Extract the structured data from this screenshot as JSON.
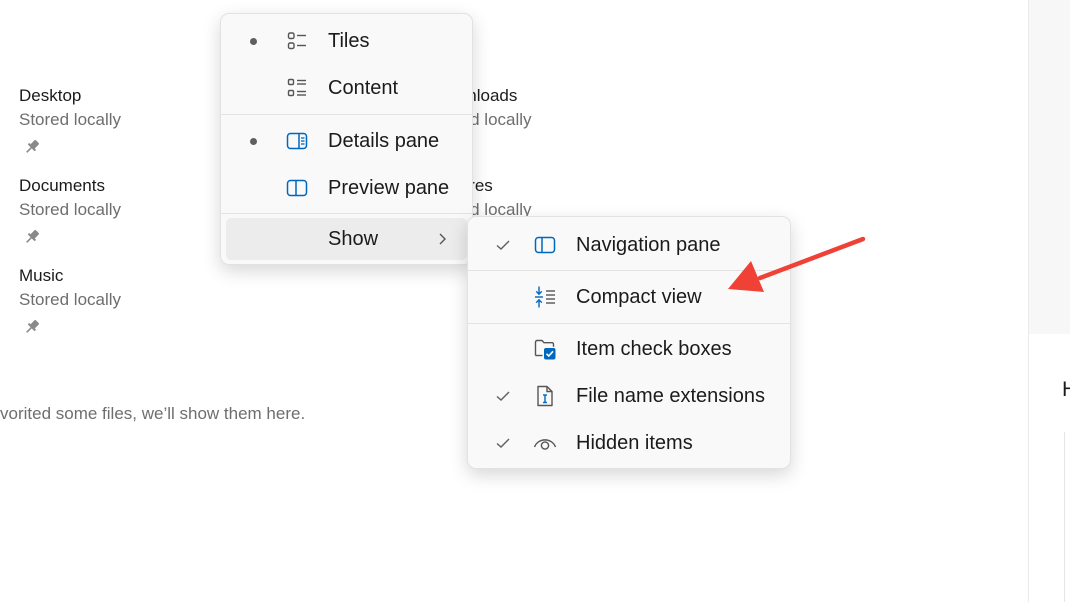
{
  "quick_access": [
    {
      "name": "Desktop",
      "status": "Stored locally"
    },
    {
      "name": "Documents",
      "status": "Stored locally"
    },
    {
      "name": "Music",
      "status": "Stored locally"
    }
  ],
  "quick_access_right": [
    {
      "name": "wnloads",
      "status": "red locally"
    },
    {
      "name": "tures",
      "status": "red locally"
    }
  ],
  "favorites_empty_message": "vorited some files, we’ll show them here.",
  "right_panel_heading_fragment": "H",
  "view_menu": {
    "items": [
      {
        "label": "Tiles",
        "icon": "tiles-icon",
        "selected": true
      },
      {
        "label": "Content",
        "icon": "content-icon",
        "selected": false
      },
      {
        "label": "Details pane",
        "icon": "details-pane-icon",
        "selected": true
      },
      {
        "label": "Preview pane",
        "icon": "preview-pane-icon",
        "selected": false
      },
      {
        "label": "Show",
        "icon": "chevron-right-icon",
        "has_submenu": true,
        "hovered": true
      }
    ]
  },
  "show_submenu": {
    "items": [
      {
        "label": "Navigation pane",
        "icon": "navigation-pane-icon",
        "checked": true
      },
      {
        "label": "Compact view",
        "icon": "compact-view-icon",
        "checked": false
      },
      {
        "label": "Item check boxes",
        "icon": "item-check-boxes-icon",
        "checked": false
      },
      {
        "label": "File name extensions",
        "icon": "file-name-extensions-icon",
        "checked": true
      },
      {
        "label": "Hidden items",
        "icon": "hidden-items-icon",
        "checked": true
      }
    ]
  },
  "colors": {
    "accent": "#0067c0",
    "arrow": "#ef4135",
    "menu_background": "#f9f9f9",
    "hover_background": "#ececec",
    "secondary_text": "#6e6e6e"
  }
}
